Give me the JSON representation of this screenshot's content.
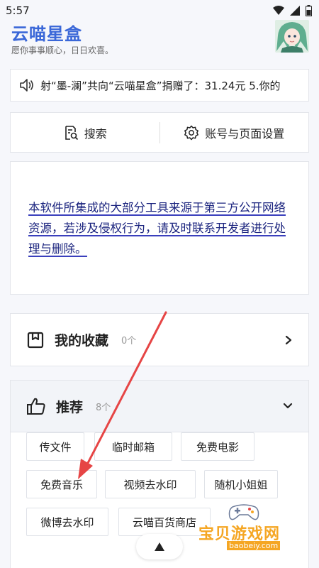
{
  "status_bar": {
    "time": "5:57"
  },
  "header": {
    "title": "云喵星盒",
    "subtitle": "愿你事事顺心，日日欢喜。"
  },
  "donation": {
    "text": "射“墨-澜”共向“云喵星盒”捐赠了：31.24元 5.你的"
  },
  "actions": {
    "search_label": "搜索",
    "settings_label": "账号与页面设置"
  },
  "notice": {
    "text": "本软件所集成的大部分工具来源于第三方公开网络资源，若涉及侵权行为，请及时联系开发者进行处理与删除。"
  },
  "favorites": {
    "label": "我的收藏",
    "count": "0个"
  },
  "recommend": {
    "label": "推荐",
    "count": "8个",
    "tags": [
      "传文件",
      "临时邮箱",
      "免费电影",
      "免费音乐",
      "视频去水印",
      "随机小姐姐",
      "微博去水印",
      "云喵百货商店"
    ]
  },
  "watermark": {
    "text": "宝贝游戏网",
    "url": "baobeiy.com"
  },
  "colors": {
    "accent": "#3a67d8",
    "notice": "#1a237e",
    "annotation_arrow": "#e64545",
    "watermark": "#f5a623"
  }
}
